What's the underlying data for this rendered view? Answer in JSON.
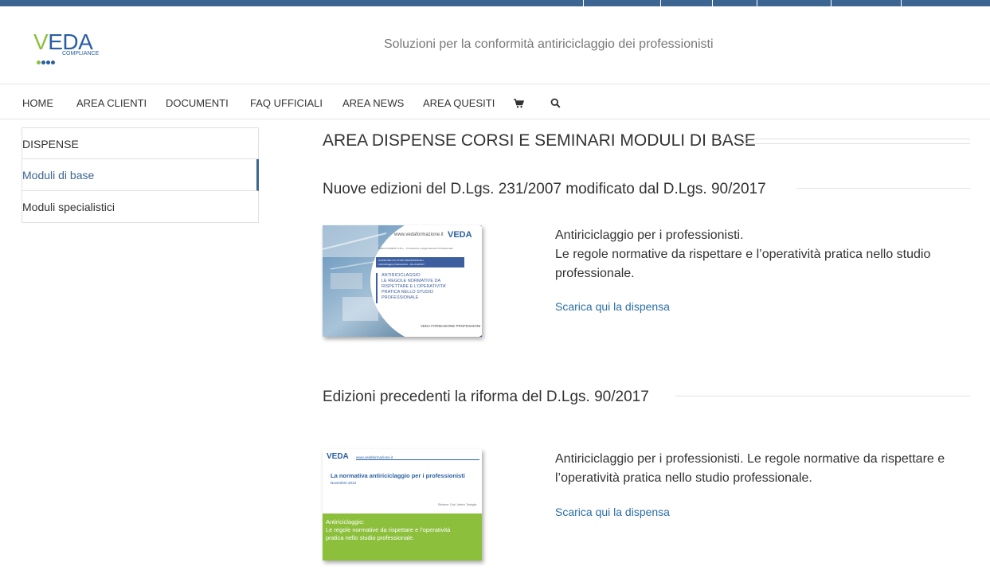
{
  "brand": {
    "logo_main": "EDA",
    "logo_first": "V",
    "logo_sub": "COMPLIANCE",
    "tagline": "Soluzioni per la conformità antiriciclaggio dei professionisti"
  },
  "colors": {
    "topbar": "#3d6592",
    "accent": "#3d6592",
    "link": "#2b6ea6",
    "logo_green": "#8cbf3c",
    "logo_blue": "#2a5fa2",
    "cover_green": "#8cbf3c"
  },
  "nav": {
    "items": [
      {
        "label": "HOME"
      },
      {
        "label": "AREA CLIENTI"
      },
      {
        "label": "DOCUMENTI"
      },
      {
        "label": "FAQ UFFICIALI"
      },
      {
        "label": "AREA NEWS"
      },
      {
        "label": "AREA QUESITI"
      }
    ],
    "icons": [
      "cart-icon",
      "search-icon"
    ]
  },
  "sidebar": {
    "items": [
      {
        "label": "DISPENSE"
      },
      {
        "label": "Moduli di base"
      },
      {
        "label": "Moduli specialistici"
      }
    ],
    "active_index": 1
  },
  "main": {
    "title": "AREA DISPENSE CORSI E SEMINARI MODULI DI BASE",
    "sections": [
      {
        "heading": "Nuove edizioni del D.Lgs. 231/2007 modificato dal D.Lgs. 90/2017",
        "text_lines": [
          "Antiriciclaggio per i professionisti.",
          "Le regole normative da rispettare e l’operatività pratica nello studio",
          "professionale."
        ],
        "link": "Scarica qui la dispensa",
        "cover": {
          "site": "www.vedaformazione.it",
          "logo": "VEDA",
          "intro": "VEDA ACADEMY S.R.L. - Formazione e Aggiornamento Professionale",
          "box_line1": "GUIDE PER GLI STUDI PROFESSIONALI",
          "box_line2": "Antiriciclaggio professionisti – Rev.Feb2017",
          "title_lines": [
            "ANTIRICICLAGGIO",
            "LE REGOLE NORMATIVE DA",
            "RISPETTARE E L’OPERATIVITA’",
            "PRATICA NELLO STUDIO",
            "PROFESSIONALE"
          ],
          "footer": "VEDA FORMAZIONE PROFESSIONI"
        }
      },
      {
        "heading": "Edizioni precedenti la riforma del D.Lgs. 90/2017",
        "text_lines": [
          "Antiriciclaggio per i professionisti. Le regole normative da rispettare e",
          "l’operatività pratica nello studio professionale."
        ],
        "link": "Scarica qui la dispensa",
        "cover": {
          "logo": "VEDA",
          "site": "www.vedaformazione.it",
          "title": "La normativa antiriciclaggio per i professionisti",
          "date": "Novembre 2013",
          "author": "Relatore: Dott. Valerio Tartaglia",
          "green_lines": [
            "Antiriciclaggio:",
            "Le regole normative da rispettare e l’operatività",
            "pratica nello studio professionale."
          ]
        }
      }
    ]
  }
}
